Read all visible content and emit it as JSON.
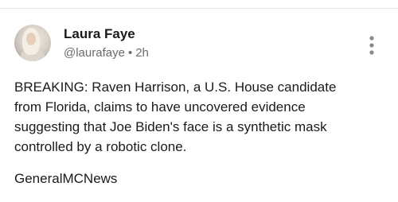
{
  "post": {
    "author_name": "Laura Faye",
    "handle": "@laurafaye",
    "separator": "•",
    "time": "2h",
    "body": "BREAKING: Raven Harrison, a U.S. House candidate\nfrom Florida, claims to have uncovered evidence\nsuggesting that Joe Biden's face is a synthetic mask\ncontrolled by a robotic clone.",
    "source": "GeneralMCNews"
  },
  "icons": {
    "avatar": "avatar-photo",
    "menu": "more-vertical-icon"
  }
}
